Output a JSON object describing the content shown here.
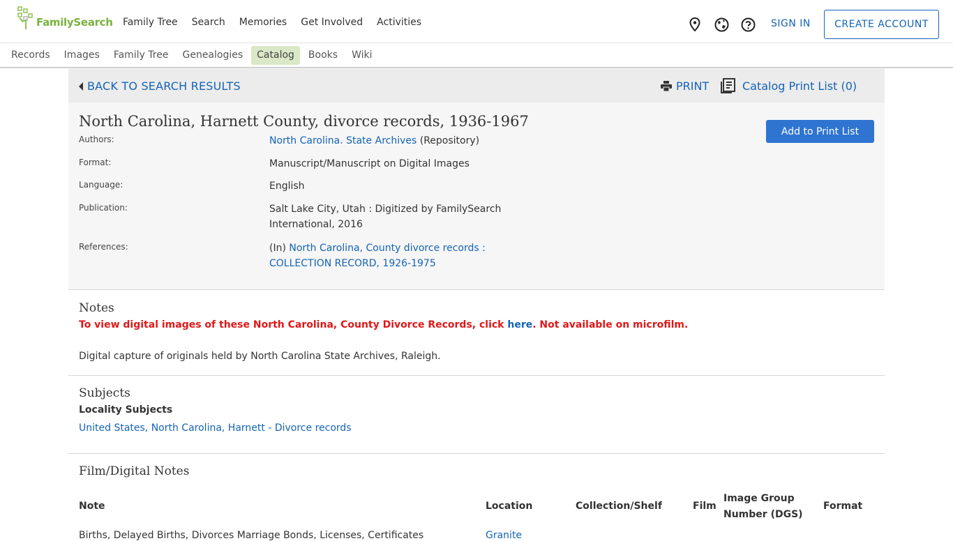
{
  "header": {
    "logo_text": "FamilySearch",
    "nav": [
      "Family Tree",
      "Search",
      "Memories",
      "Get Involved",
      "Activities"
    ],
    "sign_in": "SIGN IN",
    "create_account": "CREATE ACCOUNT",
    "icons": [
      "location-pin-icon",
      "globe-icon",
      "help-icon"
    ]
  },
  "subnav": {
    "items": [
      "Records",
      "Images",
      "Family Tree",
      "Genealogies",
      "Catalog",
      "Books",
      "Wiki"
    ],
    "active": "Catalog"
  },
  "toolbar": {
    "back": "BACK TO SEARCH RESULTS",
    "print": "PRINT",
    "print_list": "Catalog Print List (0)"
  },
  "record": {
    "title": "North Carolina, Harnett County, divorce records, 1936-1967",
    "add_button": "Add to Print List",
    "authors_label": "Authors:",
    "authors_link": "North Carolina. State Archives",
    "authors_suffix": " (Repository)",
    "format_label": "Format:",
    "format_value": "Manuscript/Manuscript on Digital Images",
    "language_label": "Language:",
    "language_value": "English",
    "publication_label": "Publication:",
    "publication_value": "Salt Lake City, Utah : Digitized by FamilySearch International, 2016",
    "references_label": "References:",
    "references_prefix": "(In) ",
    "references_link": "North Carolina, County divorce records : COLLECTION RECORD, 1926-1975"
  },
  "notes": {
    "title": "Notes",
    "red_prefix": "To view digital images of these North Carolina, County Divorce Records, click ",
    "red_link": "here",
    "red_suffix": ". Not available on microfilm.",
    "plain": "Digital capture of originals held by North Carolina State Archives, Raleigh."
  },
  "subjects": {
    "title": "Subjects",
    "subheading": "Locality Subjects",
    "link": "United States, North Carolina, Harnett - Divorce records"
  },
  "film": {
    "title": "Film/Digital Notes",
    "headers": {
      "note": "Note",
      "location": "Location",
      "collection": "Collection/Shelf",
      "film": "Film",
      "dgs_line1": "Image Group",
      "dgs_line2": "Number (DGS)",
      "format": "Format"
    },
    "row_note": "Births, Delayed Births, Divorces Marriage Bonds, Licenses, Certificates",
    "row_location": "Granite"
  }
}
